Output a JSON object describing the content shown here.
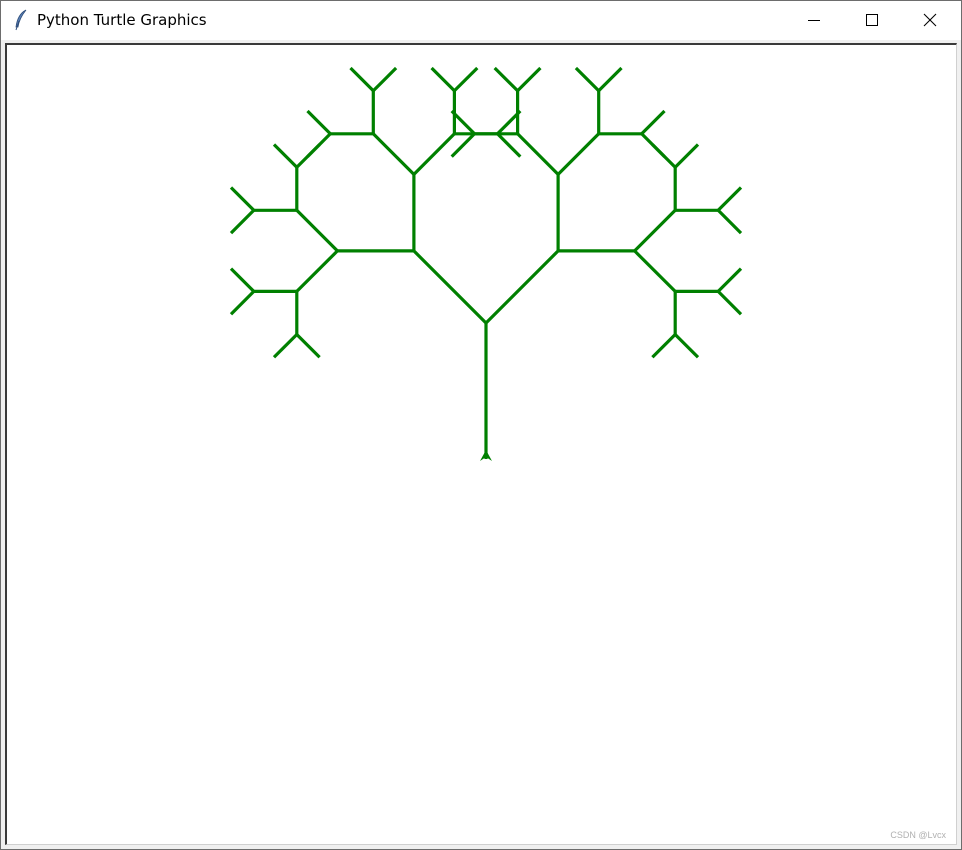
{
  "window": {
    "title": "Python Turtle Graphics",
    "app_icon": "feather-icon",
    "controls": [
      "minimize-icon",
      "maximize-icon",
      "close-icon"
    ]
  },
  "canvas": {
    "background": "#ffffff",
    "drawing": {
      "type": "fractal-tree",
      "pen_color": "#008000",
      "turtle_shape": "classic-arrow",
      "turtle_heading": "up",
      "branch_angle_degrees": 45,
      "recursion_levels": 5,
      "length_ratio": 0.75
    }
  },
  "watermark": "CSDN @Lvcx"
}
